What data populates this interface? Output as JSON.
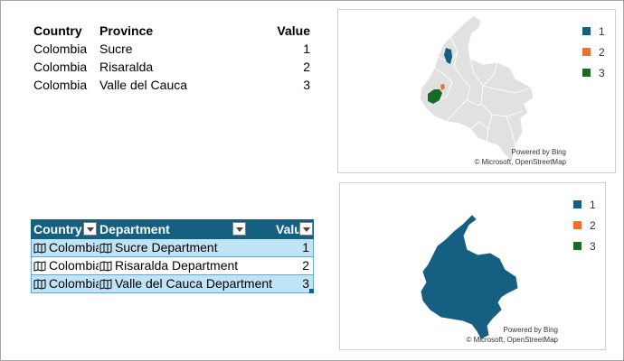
{
  "plain_table": {
    "headers": {
      "country": "Country",
      "province": "Province",
      "value": "Value"
    },
    "rows": [
      {
        "country": "Colombia",
        "province": "Sucre",
        "value": "1"
      },
      {
        "country": "Colombia",
        "province": "Risaralda",
        "value": "2"
      },
      {
        "country": "Colombia",
        "province": "Valle del Cauca",
        "value": "3"
      }
    ]
  },
  "excel_table": {
    "headers": {
      "country": "Country",
      "department": "Department",
      "value": "Value"
    },
    "rows": [
      {
        "country": "Colombia",
        "department": "Sucre Department",
        "value": "1"
      },
      {
        "country": "Colombia",
        "department": "Risaralda Department",
        "value": "2"
      },
      {
        "country": "Colombia",
        "department": "Valle del Cauca Department",
        "value": "3"
      }
    ],
    "header_color": "#156082",
    "band_color": "#c0e4f5"
  },
  "map_charts": [
    {
      "legend": [
        {
          "label": "1",
          "color": "#156082"
        },
        {
          "label": "2",
          "color": "#e97132"
        },
        {
          "label": "3",
          "color": "#196b24"
        }
      ],
      "powered_by": "Powered by Bing",
      "copyright": "© Microsoft, OpenStreetMap"
    },
    {
      "legend": [
        {
          "label": "1",
          "color": "#156082"
        },
        {
          "label": "2",
          "color": "#e97132"
        },
        {
          "label": "3",
          "color": "#196b24"
        }
      ],
      "powered_by": "Powered by Bing",
      "copyright": "© Microsoft, OpenStreetMap"
    }
  ]
}
